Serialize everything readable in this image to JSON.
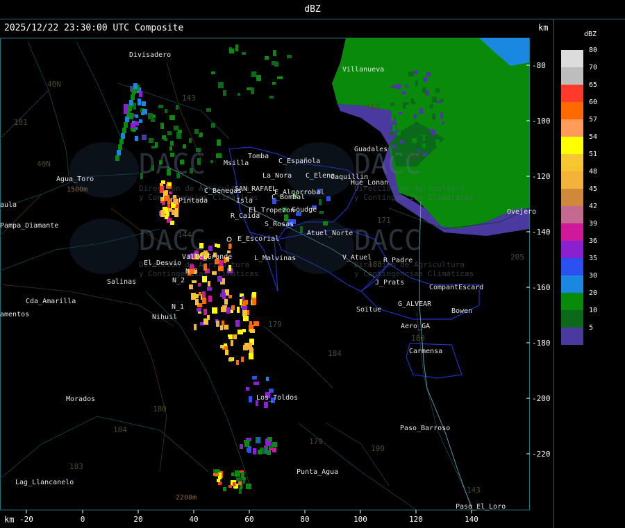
{
  "header": {
    "title": "dBZ"
  },
  "map": {
    "subtitle": "2025/12/22 23:30:00 UTC Composite",
    "km_label_top": "km",
    "km_label_bottom": "km",
    "x_ticks": [
      "-20",
      "0",
      "20",
      "40",
      "60",
      "80",
      "100",
      "120",
      "140"
    ],
    "y_ticks": [
      "-80",
      "-100",
      "-120",
      "-140",
      "-160",
      "-180",
      "-200",
      "-220"
    ],
    "watermark": {
      "brand": "DACC",
      "line1": "Dirección de Agricultura",
      "line2": "y Contingencias Climáticas"
    },
    "places": [
      "Divisadero",
      "Villanueva",
      "Guadales",
      "Tomba",
      "Msilla",
      "La_Nora",
      "C_Española",
      "C_Elena",
      "Caquillin",
      "Hue_Lonan",
      "SAN_RAFAEL",
      "C_Benegas",
      "E_Algarrobal",
      "C_Bombal",
      "C_Pintada",
      "Isla",
      "El_Tropezon",
      "Goudge",
      "R_Caida",
      "S_Rosas",
      "E_Escorial",
      "Atuel_Norte",
      "Valle_Grande",
      "L_Malvinas",
      "V_Atuel",
      "R_Padre",
      "El_Desvio",
      "N_3",
      "N_2",
      "J_Prats",
      "CompantEscard",
      "Salinas",
      "N_1",
      "Nihuil",
      "Soitue",
      "G_ALVEAR",
      "Bowen",
      "Aero_GA",
      "Carmensa",
      "Agua_Toro",
      "Pampa_Diamante",
      "Cda_Amarilla",
      "Los_Toldos",
      "Morados",
      "Paso_Barroso",
      "Punta_Agua",
      "Lag_Llancanelo",
      "Paso_El_Loro",
      "Ovejero"
    ],
    "route_numbers": [
      "143",
      "40N",
      "101",
      "40N",
      "153",
      "144",
      "171",
      "188",
      "179",
      "184",
      "180",
      "184",
      "179",
      "183",
      "180",
      "143",
      "143",
      "190",
      "205"
    ],
    "elevations": [
      "1500m",
      "2200m"
    ],
    "edge_labels": [
      "aula",
      "amentos",
      "DN",
      "N"
    ]
  },
  "legend": {
    "title": "dBZ",
    "levels": [
      {
        "value": "80",
        "color": "#dcdcdc"
      },
      {
        "value": "70",
        "color": "#bdbdbd"
      },
      {
        "value": "65",
        "color": "#ff3a2a"
      },
      {
        "value": "60",
        "color": "#ff6a00"
      },
      {
        "value": "57",
        "color": "#ff9a5a"
      },
      {
        "value": "54",
        "color": "#ffff00"
      },
      {
        "value": "51",
        "color": "#f7c530"
      },
      {
        "value": "48",
        "color": "#f3b23a"
      },
      {
        "value": "45",
        "color": "#d0883a"
      },
      {
        "value": "42",
        "color": "#c46a90"
      },
      {
        "value": "39",
        "color": "#d0189a"
      },
      {
        "value": "36",
        "color": "#8a20d0"
      },
      {
        "value": "35",
        "color": "#2a50f0"
      },
      {
        "value": "30",
        "color": "#1a88e0"
      },
      {
        "value": "20",
        "color": "#0a8a0a"
      },
      {
        "value": "10",
        "color": "#0a6a1a"
      },
      {
        "value": "5",
        "color": "#4a3aa0"
      }
    ]
  }
}
